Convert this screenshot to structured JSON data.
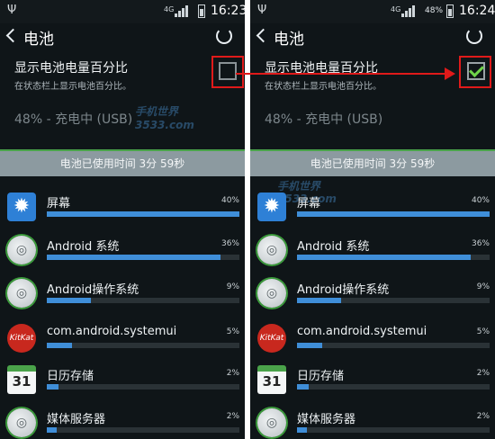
{
  "colors": {
    "accent_red": "#e01a1a",
    "bar_blue": "#3f8ed8",
    "check_green": "#6fd34a",
    "background": "#0f1518"
  },
  "status_bar": {
    "left": {
      "network": "4G",
      "percent": "",
      "time": "16:23",
      "usb_icon": "usb-icon"
    },
    "right": {
      "network": "4G",
      "percent": "48%",
      "time": "16:24",
      "usb_icon": "usb-icon"
    }
  },
  "action_bar": {
    "title": "电池",
    "back_icon": "back-arrow-icon",
    "refresh_icon": "refresh-icon"
  },
  "setting": {
    "title": "显示电池电量百分比",
    "subtitle": "在状态栏上显示电池百分比。",
    "left_checked": false,
    "right_checked": true
  },
  "charge_status": "48% - 充电中 (USB)",
  "usage_time": "电池已使用时间 3分 59秒",
  "apps": [
    {
      "name": "屏幕",
      "percent": "40%",
      "fill": 1.0,
      "icon": "gear-icon"
    },
    {
      "name": "Android 系统",
      "percent": "36%",
      "fill": 0.9,
      "icon": "android-icon"
    },
    {
      "name": "Android操作系统",
      "percent": "9%",
      "fill": 0.23,
      "icon": "android-icon"
    },
    {
      "name": "com.android.systemui",
      "percent": "5%",
      "fill": 0.13,
      "icon": "kitkat-icon"
    },
    {
      "name": "日历存储",
      "percent": "2%",
      "fill": 0.06,
      "icon": "calendar-icon"
    },
    {
      "name": "媒体服务器",
      "percent": "2%",
      "fill": 0.05,
      "icon": "android-icon"
    }
  ],
  "calendar_day": "31",
  "kitkat_text": "KitKat",
  "watermark": {
    "text1": "手机世界",
    "text2": "3533.com"
  }
}
